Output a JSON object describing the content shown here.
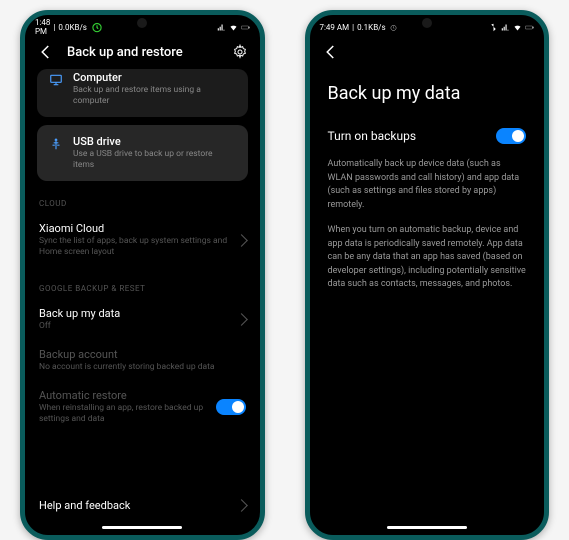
{
  "phone1": {
    "status": {
      "time": "1:48 PM",
      "net": "0.0KB/s"
    },
    "header": {
      "title": "Back up and restore"
    },
    "computer": {
      "title": "Computer",
      "sub": "Back up and restore items using a computer"
    },
    "usb": {
      "title": "USB drive",
      "sub": "Use a USB drive to back up or restore items"
    },
    "cloud_label": "CLOUD",
    "xiaomi": {
      "title": "Xiaomi Cloud",
      "sub": "Sync the list of apps, back up system settings and Home screen layout"
    },
    "google_label": "GOOGLE BACKUP & RESET",
    "backup_my_data": {
      "title": "Back up my data",
      "sub": "Off"
    },
    "backup_account": {
      "title": "Backup account",
      "sub": "No account is currently storing backed up data"
    },
    "auto_restore": {
      "title": "Automatic restore",
      "sub": "When reinstalling an app, restore backed up settings and data"
    },
    "help": {
      "title": "Help and feedback"
    }
  },
  "phone2": {
    "status": {
      "time": "7:49 AM",
      "net": "0.1KB/s"
    },
    "title": "Back up my data",
    "turn_on": "Turn on backups",
    "desc1": "Automatically back up device data (such as WLAN passwords and call history) and app data (such as settings and files stored by apps) remotely.",
    "desc2": "When you turn on automatic backup, device and app data is periodically saved remotely. App data can be any data that an app has saved (based on developer settings), including potentially sensitive data such as contacts, messages, and photos."
  }
}
